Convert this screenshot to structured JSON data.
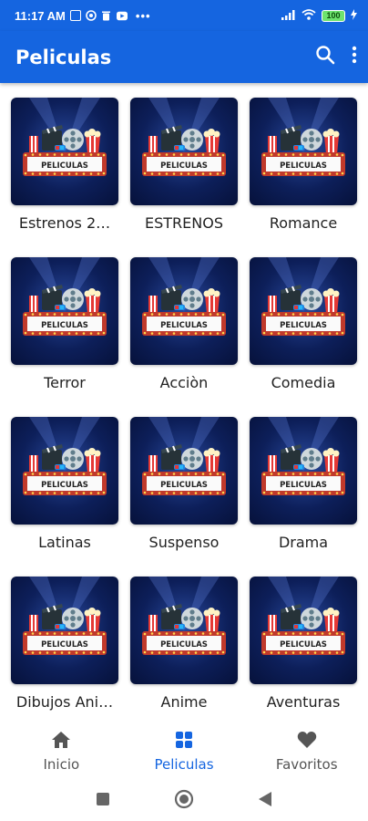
{
  "status_bar": {
    "time": "11:17 AM",
    "battery": "100",
    "icons": [
      "notification-box-icon",
      "whatsapp-icon",
      "trash-icon",
      "youtube-icon",
      "more-dots-icon",
      "signal-icon",
      "wifi-icon",
      "battery-icon",
      "charging-icon"
    ]
  },
  "app_bar": {
    "title": "Peliculas",
    "actions": [
      "search-icon",
      "more-vert-icon"
    ]
  },
  "poster": {
    "sign_text": "PELICULAS",
    "colors": {
      "bg": "#0d1f5a",
      "sign": "#c0392b",
      "bulbs": "#ffd54f"
    }
  },
  "grid": {
    "items": [
      {
        "label": "Estrenos 2…"
      },
      {
        "label": "ESTRENOS"
      },
      {
        "label": "Romance"
      },
      {
        "label": "Terror"
      },
      {
        "label": "Acciòn"
      },
      {
        "label": "Comedia"
      },
      {
        "label": "Latinas"
      },
      {
        "label": "Suspenso"
      },
      {
        "label": "Drama"
      },
      {
        "label": "Dibujos Ani…"
      },
      {
        "label": "Anime"
      },
      {
        "label": "Aventuras"
      }
    ]
  },
  "bottom_nav": {
    "items": [
      {
        "label": "Inicio",
        "icon": "home-icon",
        "active": false
      },
      {
        "label": "Peliculas",
        "icon": "grid-icon",
        "active": true
      },
      {
        "label": "Favoritos",
        "icon": "heart-icon",
        "active": false
      }
    ]
  },
  "system_nav": [
    "square-recents-icon",
    "circle-home-icon",
    "triangle-back-icon"
  ],
  "colors": {
    "primary": "#1565e0",
    "text": "#222222"
  }
}
